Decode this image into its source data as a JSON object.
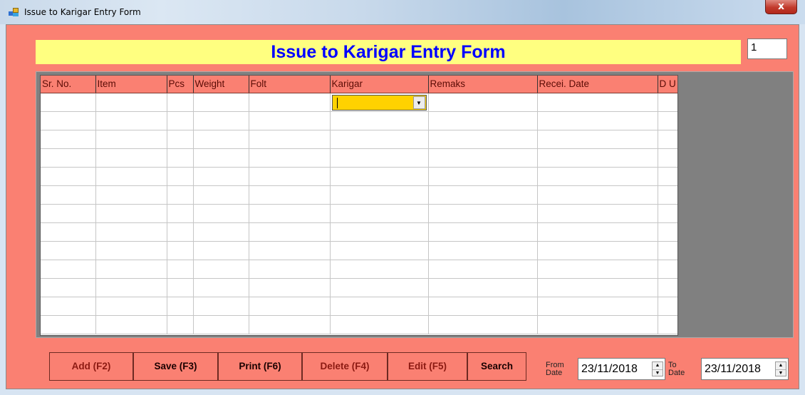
{
  "window": {
    "title": "Issue to Karigar Entry Form",
    "close_glyph": "x"
  },
  "header": {
    "title": "Issue to Karigar Entry Form",
    "counter_value": "1"
  },
  "grid": {
    "columns": [
      "Sr. No.",
      "Item",
      "Pcs",
      "Weight",
      "Folt",
      "Karigar",
      "Remaks",
      "Recei. Date",
      "D U"
    ],
    "rows": 13,
    "active_cell": {
      "column": "Karigar",
      "value": ""
    }
  },
  "buttons": {
    "add": "Add (F2)",
    "save": "Save (F3)",
    "print": "Print (F6)",
    "delete": "Delete (F4)",
    "edit": "Edit (F5)",
    "search": "Search"
  },
  "filters": {
    "from_label_1": "From",
    "from_label_2": "Date",
    "from_date": "23/11/2018",
    "to_label_1": "To",
    "to_label_2": "Date",
    "to_date": "23/11/2018"
  },
  "colors": {
    "form_background": "#fa8072",
    "header_background": "#ffff80",
    "header_text": "#0000ff",
    "active_cell": "#ffd200",
    "grid_background": "#808080"
  }
}
